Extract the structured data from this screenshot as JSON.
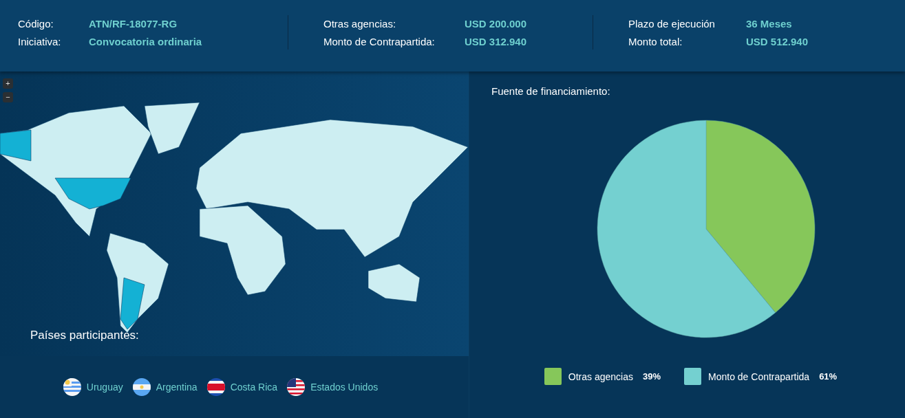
{
  "summary": [
    {
      "rows": [
        {
          "label": "Código:",
          "value": "ATN/RF-18077-RG"
        },
        {
          "label": "Iniciativa:",
          "value": "Convocatoria ordinaria"
        }
      ]
    },
    {
      "rows": [
        {
          "label": "Otras agencias:",
          "value": "USD 200.000"
        },
        {
          "label": "Monto de Contrapartida:",
          "value": "USD 312.940"
        }
      ]
    },
    {
      "rows": [
        {
          "label": "Plazo de ejecución",
          "value": "36 Meses"
        },
        {
          "label": "Monto total:",
          "value": "USD 512.940"
        }
      ]
    }
  ],
  "map": {
    "zoom_in": "+",
    "zoom_out": "−",
    "title": "Países participantes:"
  },
  "countries": [
    {
      "name": "Uruguay",
      "kind": "uruguay"
    },
    {
      "name": "Argentina",
      "kind": "argentina"
    },
    {
      "name": "Costa Rica",
      "kind": "costarica"
    },
    {
      "name": "Estados Unidos",
      "kind": "usa"
    }
  ],
  "funding": {
    "chart_data": {
      "type": "pie",
      "title": "Fuente de financiamiento:",
      "categories": [
        "Otras agencias",
        "Monto de Contrapartida"
      ],
      "values": [
        39,
        61
      ]
    },
    "legend": [
      {
        "percent": "39%",
        "color": "#86c75a"
      },
      {
        "percent": "61%",
        "color": "#74d0d0"
      }
    ]
  }
}
